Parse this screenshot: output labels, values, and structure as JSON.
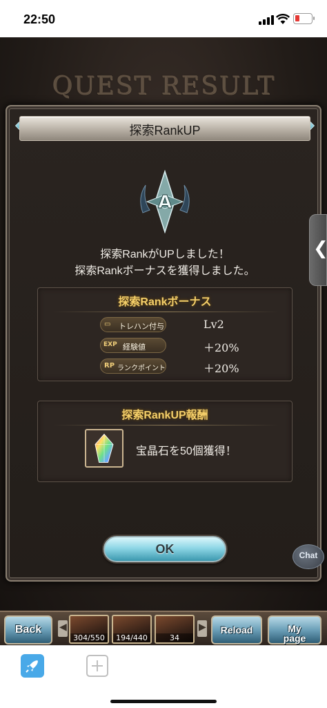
{
  "status_bar": {
    "time": "22:50"
  },
  "background": {
    "quest_title": "QUEST RESULT"
  },
  "dialog": {
    "title": "探索RankUP",
    "message_line1": "探索RankがUPしました！",
    "message_line2": "探索Rankボーナスを獲得しました。",
    "bonus_panel": {
      "title": "探索Rankボーナス",
      "rows": [
        {
          "icon": "treasure-hunt-icon",
          "icon_text": "▭",
          "label": "トレハン付与",
          "value": "Lv2"
        },
        {
          "icon": "exp-icon",
          "icon_text": "EXP",
          "label": "経験値",
          "value": "＋20%"
        },
        {
          "icon": "rp-icon",
          "icon_text": "RP",
          "label": "ランクポイント",
          "value": "＋20%"
        }
      ]
    },
    "reward_panel": {
      "title": "探索RankUP報酬",
      "item_icon": "crystal-icon",
      "text": "宝晶石を50個獲得！"
    },
    "ok_label": "OK",
    "emblem_letter": "A"
  },
  "side_tab": {
    "glyph": "❮"
  },
  "chat": {
    "label": "Chat"
  },
  "bottom_nav": {
    "back_label": "Back",
    "reload_label": "Reload",
    "mypage_label": "My page",
    "thumbs": [
      {
        "count": "304/550"
      },
      {
        "count": "194/440"
      },
      {
        "count": "34"
      }
    ]
  },
  "colors": {
    "gold_title": "#f4cf6a",
    "ok_button": "#8fd7e6",
    "panel_bg": "#2d2622"
  }
}
